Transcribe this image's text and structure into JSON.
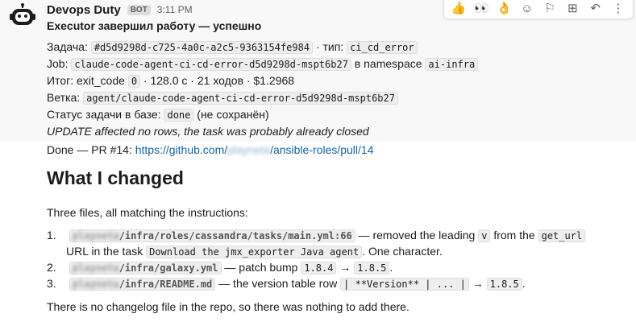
{
  "message": {
    "sender": "Devops Duty",
    "badge": "BOT",
    "time": "3:11 PM",
    "title": "Executor завершил работу — успешно",
    "task_label": "Задача:",
    "task_id": "#d5d9298d-c725-4a0c-a2c5-9363154fe984",
    "type_label": "· тип:",
    "type_value": "ci_cd_error",
    "job_label": "Job:",
    "job_value": "claude-code-agent-ci-cd-error-d5d9298d-mspt6b27",
    "namespace_label": "в namespace",
    "namespace_value": "ai-infra",
    "result_label": "Итог: exit_code",
    "exit_code": "0",
    "result_rest": "· 128.0 с · 21 ходов · $1.2968",
    "branch_label": "Ветка:",
    "branch_value": "agent/claude-code-agent-ci-cd-error-d5d9298d-mspt6b27",
    "status_label": "Статус задачи в базе:",
    "status_value": "done",
    "status_note": "(не сохранён)",
    "update_note": "UPDATE affected no rows, the task was probably already closed",
    "done_prefix": "Done — PR #14:",
    "pr_link_start": "https://github.com/",
    "pr_link_blur": "playneta",
    "pr_link_end": "/ansible-roles/pull/14"
  },
  "body": {
    "heading": "What I changed",
    "intro": "Three files, all matching the instructions:",
    "items": [
      {
        "num": "1.",
        "path_blur": "playneta",
        "path": "/infra/roles/cassandra/tasks/main.yml:66",
        "text1": "— removed the leading",
        "code1": "v",
        "text2": "from the",
        "code2": "get_url",
        "text3": "URL in the task",
        "code3": "Download the jmx_exporter Java agent",
        "text4": ". One character."
      },
      {
        "num": "2.",
        "path_blur": "playneta",
        "path": "/infra/galaxy.yml",
        "text1": "— patch bump",
        "code1": "1.8.4",
        "arrow": "→",
        "code2": "1.8.5",
        "end": "."
      },
      {
        "num": "3.",
        "path_blur": "playneta",
        "path": "/infra/README.md",
        "text1": "— the version table row",
        "code1": "| **Version** | ... |",
        "arrow": "→",
        "code2": "1.8.5",
        "end": "."
      }
    ],
    "outro": "There is no changelog file in the repo, so there was nothing to add there."
  },
  "toolbar": {
    "icons": [
      "👍",
      "👀",
      "👌",
      "☺",
      "⚐",
      "⊞",
      "↶",
      "⋮"
    ]
  }
}
